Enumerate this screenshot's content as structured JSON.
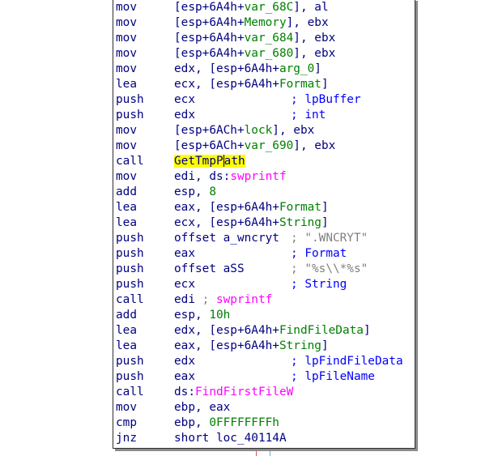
{
  "colors": {
    "text": "#000080",
    "name": "#008000",
    "import": "#ff00ff",
    "comment": "#0000ff",
    "string": "#808080",
    "highlight": "#ffff00"
  },
  "rows": [
    {
      "mnemonic": "mov",
      "operand": [
        {
          "t": "[esp+6A4h+",
          "c": "plain"
        },
        {
          "t": "var_68C",
          "c": "name"
        },
        {
          "t": "], al",
          "c": "plain"
        }
      ]
    },
    {
      "mnemonic": "mov",
      "operand": [
        {
          "t": "[esp+6A4h+",
          "c": "plain"
        },
        {
          "t": "Memory",
          "c": "name"
        },
        {
          "t": "], ebx",
          "c": "plain"
        }
      ]
    },
    {
      "mnemonic": "mov",
      "operand": [
        {
          "t": "[esp+6A4h+",
          "c": "plain"
        },
        {
          "t": "var_684",
          "c": "name"
        },
        {
          "t": "], ebx",
          "c": "plain"
        }
      ]
    },
    {
      "mnemonic": "mov",
      "operand": [
        {
          "t": "[esp+6A4h+",
          "c": "plain"
        },
        {
          "t": "var_680",
          "c": "name"
        },
        {
          "t": "], ebx",
          "c": "plain"
        }
      ]
    },
    {
      "mnemonic": "mov",
      "operand": [
        {
          "t": "edx, [esp+6A4h+",
          "c": "plain"
        },
        {
          "t": "arg_0",
          "c": "name"
        },
        {
          "t": "]",
          "c": "plain"
        }
      ]
    },
    {
      "mnemonic": "lea",
      "operand": [
        {
          "t": "ecx, [esp+6A4h+",
          "c": "plain"
        },
        {
          "t": "Format",
          "c": "name"
        },
        {
          "t": "]",
          "c": "plain"
        }
      ]
    },
    {
      "mnemonic": "push",
      "operand": [
        {
          "t": "ecx",
          "c": "plain"
        }
      ],
      "comment": "; lpBuffer"
    },
    {
      "mnemonic": "push",
      "operand": [
        {
          "t": "edx",
          "c": "plain"
        }
      ],
      "comment": "; int"
    },
    {
      "mnemonic": "mov",
      "operand": [
        {
          "t": "[esp+6ACh+",
          "c": "plain"
        },
        {
          "t": "lock",
          "c": "name"
        },
        {
          "t": "], ebx",
          "c": "plain"
        }
      ]
    },
    {
      "mnemonic": "mov",
      "operand": [
        {
          "t": "[esp+6ACh+",
          "c": "plain"
        },
        {
          "t": "var_690",
          "c": "name"
        },
        {
          "t": "], ebx",
          "c": "plain"
        }
      ]
    },
    {
      "mnemonic": "call",
      "operand": [
        {
          "t": "GetTmpP",
          "c": "hl"
        },
        {
          "t": "",
          "c": "caret"
        },
        {
          "t": "ath",
          "c": "hl"
        }
      ]
    },
    {
      "mnemonic": "mov",
      "operand": [
        {
          "t": "edi, ds:",
          "c": "plain"
        },
        {
          "t": "swprintf",
          "c": "imp"
        }
      ]
    },
    {
      "mnemonic": "add",
      "operand": [
        {
          "t": "esp, ",
          "c": "plain"
        },
        {
          "t": "8",
          "c": "name"
        }
      ]
    },
    {
      "mnemonic": "lea",
      "operand": [
        {
          "t": "eax, [esp+6A4h+",
          "c": "plain"
        },
        {
          "t": "Format",
          "c": "name"
        },
        {
          "t": "]",
          "c": "plain"
        }
      ]
    },
    {
      "mnemonic": "lea",
      "operand": [
        {
          "t": "ecx, [esp+6A4h+",
          "c": "plain"
        },
        {
          "t": "String",
          "c": "name"
        },
        {
          "t": "]",
          "c": "plain"
        }
      ]
    },
    {
      "mnemonic": "push",
      "operand": [
        {
          "t": "offset a_wncryt",
          "c": "plain"
        }
      ],
      "comment_parts": [
        {
          "t": "; ",
          "c": "semi"
        },
        {
          "t": "\".WNCRYT\"",
          "c": "str"
        }
      ]
    },
    {
      "mnemonic": "push",
      "operand": [
        {
          "t": "eax",
          "c": "plain"
        }
      ],
      "comment": "; Format"
    },
    {
      "mnemonic": "push",
      "operand": [
        {
          "t": "offset aSS",
          "c": "plain"
        }
      ],
      "comment_parts": [
        {
          "t": "; ",
          "c": "semi"
        },
        {
          "t": "\"%s\\\\*%s\"",
          "c": "str"
        }
      ]
    },
    {
      "mnemonic": "push",
      "operand": [
        {
          "t": "ecx",
          "c": "plain"
        }
      ],
      "comment": "; String"
    },
    {
      "mnemonic": "call",
      "operand": [
        {
          "t": "edi ",
          "c": "plain"
        },
        {
          "t": "; ",
          "c": "semi"
        },
        {
          "t": "swprintf",
          "c": "imp"
        }
      ]
    },
    {
      "mnemonic": "add",
      "operand": [
        {
          "t": "esp, ",
          "c": "plain"
        },
        {
          "t": "10h",
          "c": "name"
        }
      ]
    },
    {
      "mnemonic": "lea",
      "operand": [
        {
          "t": "edx, [esp+6A4h+",
          "c": "plain"
        },
        {
          "t": "FindFileData",
          "c": "name"
        },
        {
          "t": "]",
          "c": "plain"
        }
      ]
    },
    {
      "mnemonic": "lea",
      "operand": [
        {
          "t": "eax, [esp+6A4h+",
          "c": "plain"
        },
        {
          "t": "String",
          "c": "name"
        },
        {
          "t": "]",
          "c": "plain"
        }
      ]
    },
    {
      "mnemonic": "push",
      "operand": [
        {
          "t": "edx",
          "c": "plain"
        }
      ],
      "comment": "; lpFindFileData"
    },
    {
      "mnemonic": "push",
      "operand": [
        {
          "t": "eax",
          "c": "plain"
        }
      ],
      "comment": "; lpFileName"
    },
    {
      "mnemonic": "call",
      "operand": [
        {
          "t": "ds:",
          "c": "plain"
        },
        {
          "t": "FindFirstFileW",
          "c": "imp"
        }
      ]
    },
    {
      "mnemonic": "mov",
      "operand": [
        {
          "t": "ebp, eax",
          "c": "plain"
        }
      ]
    },
    {
      "mnemonic": "cmp",
      "operand": [
        {
          "t": "ebp, ",
          "c": "plain"
        },
        {
          "t": "0FFFFFFFFh",
          "c": "name"
        }
      ]
    },
    {
      "mnemonic": "jnz",
      "operand": [
        {
          "t": "short loc_40114A",
          "c": "plain"
        }
      ]
    }
  ]
}
